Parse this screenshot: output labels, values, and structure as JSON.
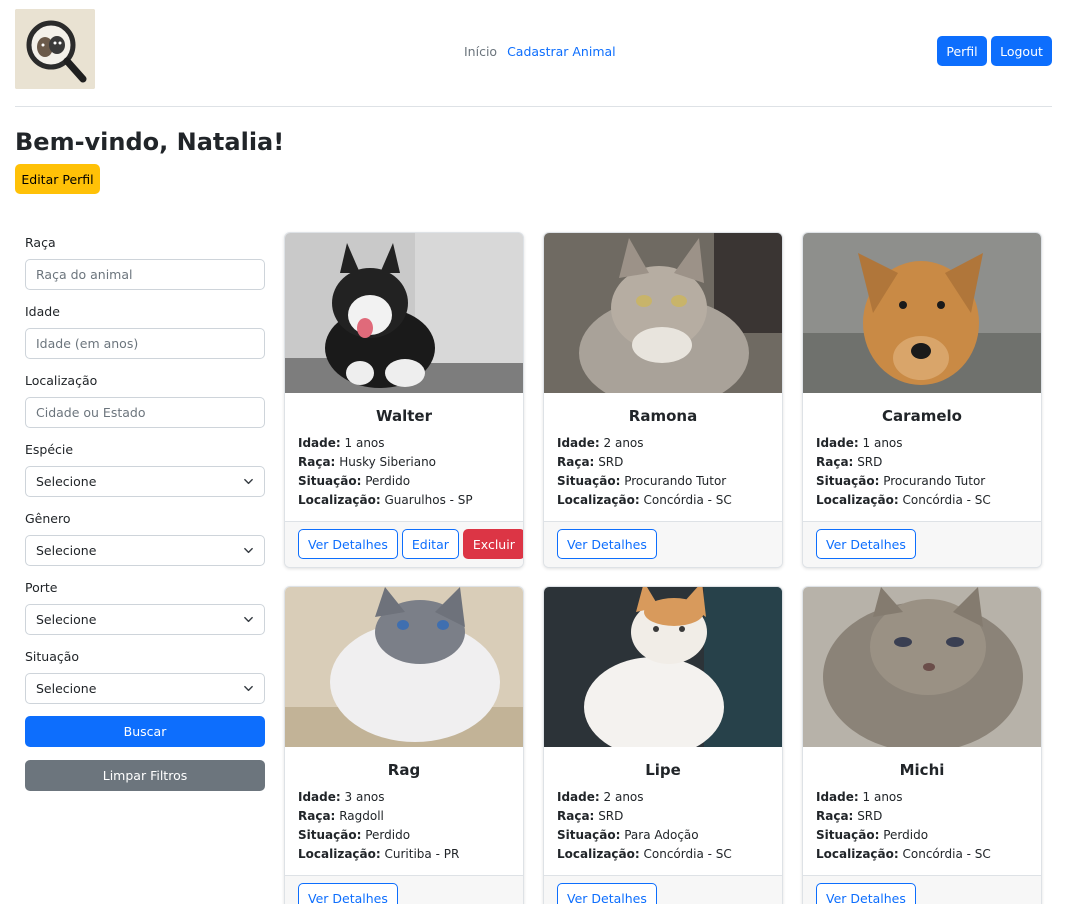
{
  "header": {
    "logo_alt": "logo",
    "nav": {
      "home": "Início",
      "register_animal": "Cadastrar Animal"
    },
    "profile_button": "Perfil",
    "logout_button": "Logout"
  },
  "welcome": {
    "title": "Bem-vindo, Natalia!",
    "edit_profile_button": "Editar Perfil"
  },
  "filters": {
    "breed_label": "Raça",
    "breed_placeholder": "Raça do animal",
    "age_label": "Idade",
    "age_placeholder": "Idade (em anos)",
    "location_label": "Localização",
    "location_placeholder": "Cidade ou Estado",
    "species_label": "Espécie",
    "species_value": "Selecione",
    "gender_label": "Gênero",
    "gender_value": "Selecione",
    "size_label": "Porte",
    "size_value": "Selecione",
    "status_label": "Situação",
    "status_value": "Selecione",
    "search_button": "Buscar",
    "clear_button": "Limpar Filtros"
  },
  "labels": {
    "age": "Idade:",
    "breed": "Raça:",
    "status": "Situação:",
    "location": "Localização:",
    "details_button": "Ver Detalhes",
    "edit_button": "Editar",
    "delete_button": "Excluir"
  },
  "animals": [
    {
      "name": "Walter",
      "age": "1 anos",
      "breed": "Husky Siberiano",
      "status": "Perdido",
      "location": "Guarulhos - SP"
    },
    {
      "name": "Ramona",
      "age": "2 anos",
      "breed": "SRD",
      "status": "Procurando Tutor",
      "location": "Concórdia - SC"
    },
    {
      "name": "Caramelo",
      "age": "1 anos",
      "breed": "SRD",
      "status": "Procurando Tutor",
      "location": "Concórdia - SC"
    },
    {
      "name": "Rag",
      "age": "3 anos",
      "breed": "Ragdoll",
      "status": "Perdido",
      "location": "Curitiba - PR"
    },
    {
      "name": "Lipe",
      "age": "2 anos",
      "breed": "SRD",
      "status": "Para Adoção",
      "location": "Concórdia - SC"
    },
    {
      "name": "Michi",
      "age": "1 anos",
      "breed": "SRD",
      "status": "Perdido",
      "location": "Concórdia - SC"
    }
  ],
  "colors": {
    "primary": "#0d6efd",
    "warning": "#ffc107",
    "danger": "#dc3545",
    "secondary": "#6c757d"
  }
}
